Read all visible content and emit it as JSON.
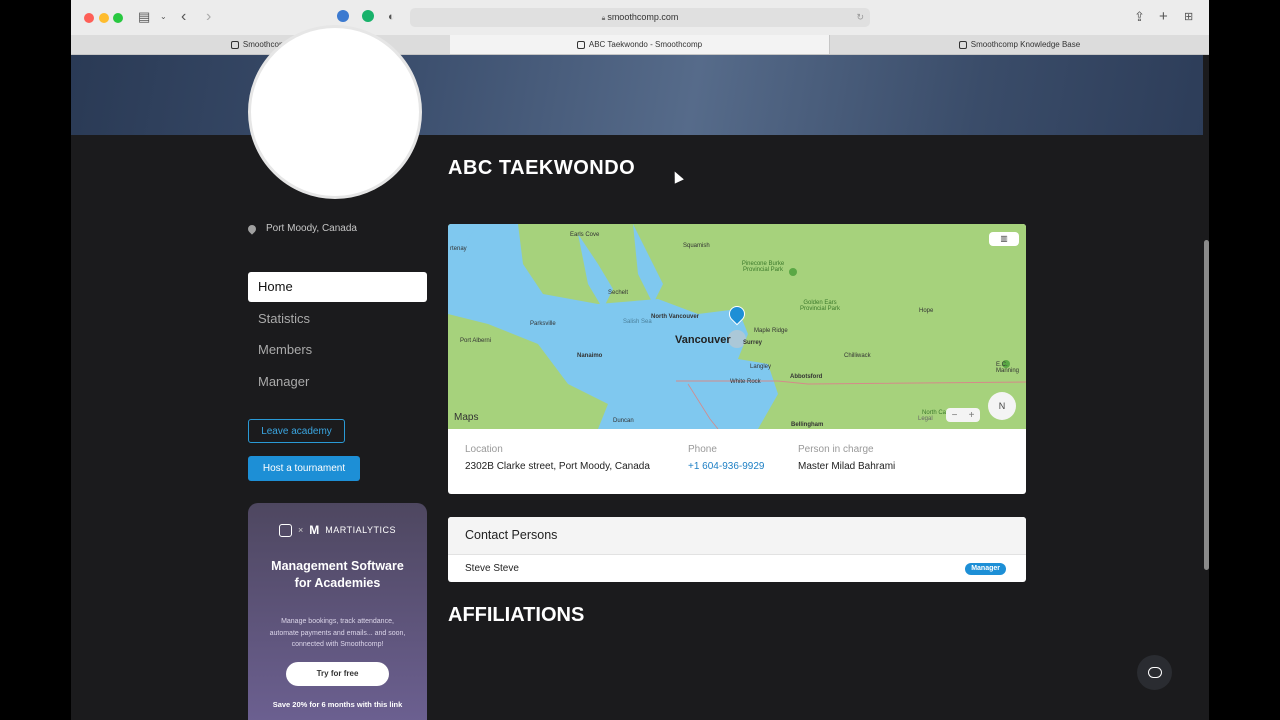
{
  "browser": {
    "url": "smoothcomp.com",
    "tabs": [
      {
        "label": "Smoothcomp",
        "active": false
      },
      {
        "label": "ABC Taekwondo - Smoothcomp",
        "active": true
      },
      {
        "label": "Smoothcomp Knowledge Base",
        "active": false
      }
    ]
  },
  "academy": {
    "name": "ABC TAEKWONDO",
    "location_short": "Port Moody, Canada"
  },
  "sidebar": {
    "nav": [
      {
        "label": "Home",
        "active": true
      },
      {
        "label": "Statistics",
        "active": false
      },
      {
        "label": "Members",
        "active": false
      },
      {
        "label": "Manager",
        "active": false
      }
    ],
    "leave_label": "Leave academy",
    "host_label": "Host a tournament"
  },
  "promo": {
    "brand": "MARTIALYTICS",
    "separator": "×",
    "title": "Management Software for Academies",
    "description": "Manage bookings, track attendance, automate payments and emails... and soon, connected with Smoothcomp!",
    "cta": "Try for free",
    "offer": "Save 20% for 6 months with this link"
  },
  "map": {
    "attribution": "Maps",
    "compass": "N",
    "labels": {
      "vancouver": "Vancouver",
      "north_vancouver": "North Vancouver",
      "surrey": "Surrey",
      "langley": "Langley",
      "maple_ridge": "Maple Ridge",
      "abbotsford": "Abbotsford",
      "chilliwack": "Chilliwack",
      "nanaimo": "Nanaimo",
      "squamish": "Squamish",
      "sechelt": "Sechelt",
      "parksville": "Parksville",
      "port_alberni": "Port Alberni",
      "white_rock": "White Rock",
      "bellingham": "Bellingham",
      "hope": "Hope",
      "earls_cove": "Earls Cove",
      "duncan": "Duncan",
      "salish_sea": "Salish Sea",
      "pinecone": "Pinecone Burke Provincial Park",
      "golden_ears": "Golden Ears Provincial Park",
      "ec_manning": "E.C. Manning",
      "north_cascades": "North Ca",
      "tenay": "rtenay",
      "legal": "Legal"
    }
  },
  "details": {
    "location_label": "Location",
    "location_value": "2302B Clarke street, Port Moody, Canada",
    "phone_label": "Phone",
    "phone_value": "+1 604-936-9929",
    "person_label": "Person in charge",
    "person_value": "Master Milad Bahrami"
  },
  "contacts": {
    "title": "Contact Persons",
    "rows": [
      {
        "name": "Steve Steve",
        "role": "Manager"
      }
    ]
  },
  "affiliations_title": "AFFILIATIONS",
  "colors": {
    "accent": "#1d8fd6",
    "page_bg": "#1b1b1d",
    "map_land": "#a6d27c",
    "map_water": "#7fc8ef"
  }
}
